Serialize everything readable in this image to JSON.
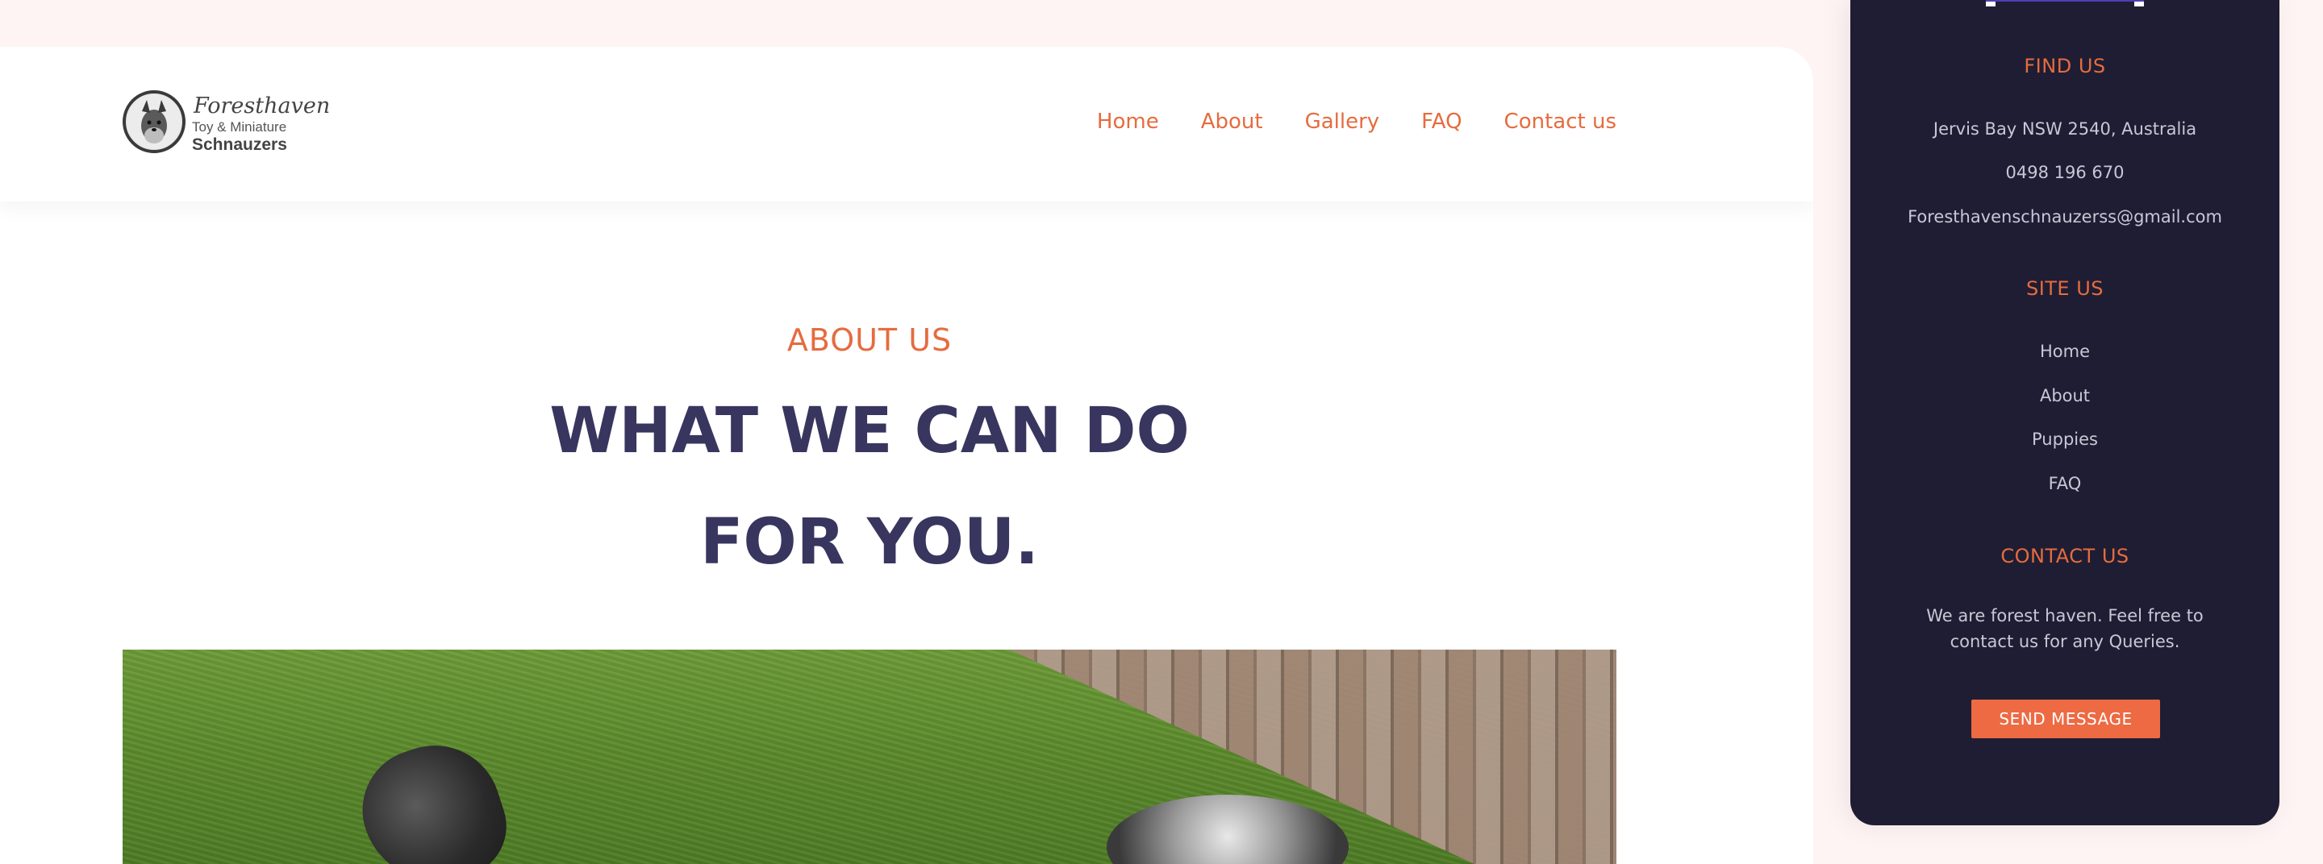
{
  "logo": {
    "script_text": "Foresthaven",
    "sub_text": "Toy & Miniature",
    "name_text": "Schnauzers"
  },
  "nav": {
    "items": [
      {
        "label": "Home"
      },
      {
        "label": "About"
      },
      {
        "label": "Gallery"
      },
      {
        "label": "FAQ"
      },
      {
        "label": "Contact us"
      }
    ]
  },
  "main": {
    "eyebrow": "ABOUT US",
    "headline_line1": "WHAT WE CAN DO",
    "headline_line2": "FOR YOU."
  },
  "sidebar": {
    "find_us": {
      "title": "FIND US",
      "address": "Jervis Bay NSW 2540, Australia",
      "phone": "0498 196 670",
      "email": "Foresthavenschnauzerss@gmail.com"
    },
    "site_us": {
      "title": "SITE US",
      "links": [
        {
          "label": "Home"
        },
        {
          "label": "About"
        },
        {
          "label": "Puppies"
        },
        {
          "label": "FAQ"
        }
      ]
    },
    "contact_us": {
      "title": "CONTACT US",
      "text": "We are forest haven. Feel free to contact us for any Queries.",
      "button_label": "SEND MESSAGE"
    }
  },
  "colors": {
    "accent": "#e56c3f",
    "headline": "#38355f",
    "sidebar_bg": "#1f1d33",
    "button_bg": "#ed6a43"
  }
}
